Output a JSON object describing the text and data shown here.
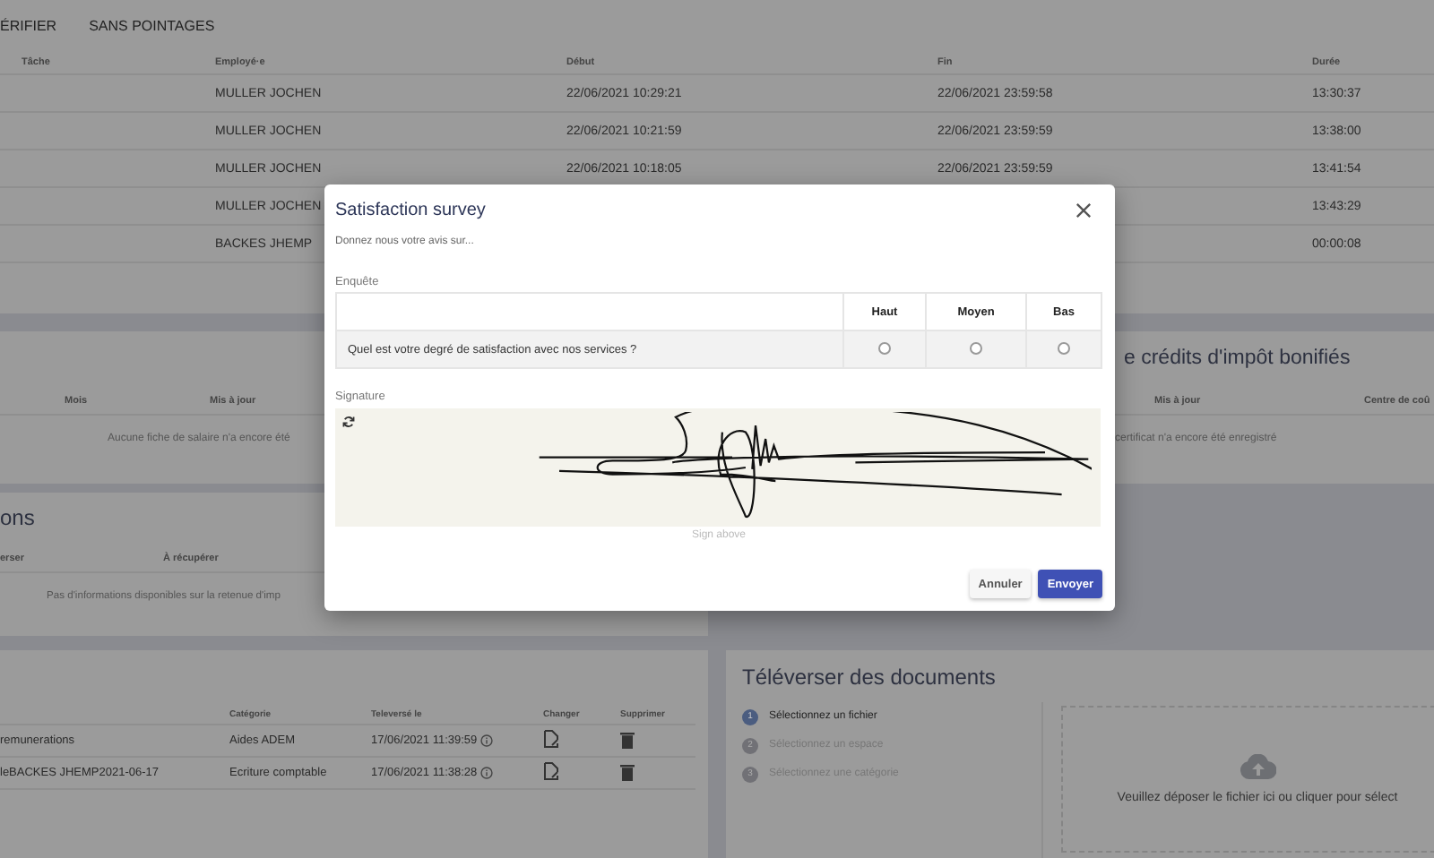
{
  "tabs": [
    "ÉRIFIER",
    "SANS POINTAGES"
  ],
  "timesheet": {
    "columns": [
      "Tâche",
      "Employé·e",
      "Début",
      "Fin",
      "Durée"
    ],
    "rows": [
      [
        "",
        "MULLER JOCHEN",
        "22/06/2021 10:29:21",
        "22/06/2021 23:59:58",
        "13:30:37"
      ],
      [
        "",
        "MULLER JOCHEN",
        "22/06/2021 10:21:59",
        "22/06/2021 23:59:59",
        "13:38:00"
      ],
      [
        "",
        "MULLER JOCHEN",
        "22/06/2021 10:18:05",
        "22/06/2021 23:59:59",
        "13:41:54"
      ],
      [
        "",
        "MULLER JOCHEN",
        "",
        "",
        "13:43:29"
      ],
      [
        "",
        "BACKES JHEMP",
        "",
        "",
        "00:00:08"
      ]
    ]
  },
  "payslips": {
    "columns": [
      "Mois",
      "Mis à jour"
    ],
    "empty": "Aucune fiche de salaire n'a encore été"
  },
  "tax_credits": {
    "title": "e crédits d'impôt bonifiés",
    "columns": [
      "Mis à jour",
      "Centre de coû"
    ],
    "empty": "certificat n'a encore été enregistré"
  },
  "withholding": {
    "title": "ons",
    "columns": [
      "erser",
      "À récupérer"
    ],
    "empty": "Pas d'informations disponibles sur la retenue d'imp"
  },
  "documents": {
    "columns": [
      "Catégorie",
      "Televersé le",
      "Changer",
      "Supprimer"
    ],
    "rows": [
      {
        "name": "remunerations",
        "category": "Aides ADEM",
        "uploaded": "17/06/2021 11:39:59"
      },
      {
        "name": "leBACKES JHEMP2021-06-17",
        "category": "Ecriture comptable",
        "uploaded": "17/06/2021 11:38:28"
      }
    ]
  },
  "upload": {
    "title": "Téléverser des documents",
    "steps": [
      {
        "number": "1",
        "label": "Sélectionnez un fichier",
        "active": true
      },
      {
        "number": "2",
        "label": "Sélectionnez un espace",
        "active": false
      },
      {
        "number": "3",
        "label": "Sélectionnez une catégorie",
        "active": false
      }
    ],
    "dropzone": "Veuillez déposer le fichier ici ou cliquer pour sélect"
  },
  "dialog": {
    "title": "Satisfaction survey",
    "subtitle": "Donnez nous votre avis sur...",
    "survey_label": "Enquête",
    "options": [
      "Haut",
      "Moyen",
      "Bas"
    ],
    "questions": [
      {
        "text": "Quel est votre degré de satisfaction avec nos services ?",
        "answers": [
          {
            "selected": false
          },
          {
            "selected": false
          },
          {
            "selected": false
          }
        ]
      }
    ],
    "signature_label": "Signature",
    "signature_hint": "Sign above",
    "buttons": [
      "Annuler",
      "Envoyer"
    ]
  }
}
